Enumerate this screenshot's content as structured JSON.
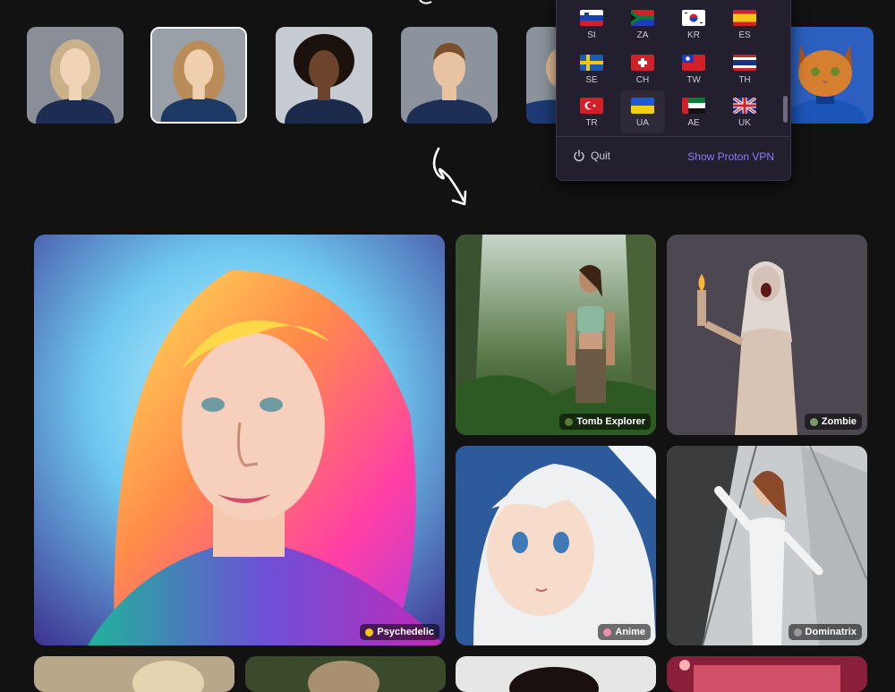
{
  "avatars": [
    {
      "name": "portrait-1",
      "bg": "#8a8f97",
      "skin": "#f1d3b6",
      "hair": "#c9b28a",
      "shirt": "#1d2c52"
    },
    {
      "name": "portrait-2",
      "bg": "#9aa0a8",
      "skin": "#efcfae",
      "hair": "#b88d5a",
      "shirt": "#1d3a66",
      "selected": true
    },
    {
      "name": "portrait-3",
      "bg": "#c7cbd2",
      "skin": "#6b442b",
      "hair": "#1b120d",
      "shirt": "#1b2a4a"
    },
    {
      "name": "portrait-4",
      "bg": "#8c939c",
      "skin": "#e8c3a2",
      "hair": "#7a4f2c",
      "shirt": "#1d2f55"
    },
    {
      "name": "portrait-5",
      "bg": "#8c939c",
      "skin": "#e1b692",
      "hair": "#5a3a22",
      "shirt": "#1d3a74"
    },
    {
      "name": "portrait-cat",
      "bg": "#2c5fbf",
      "skin": "#d58030",
      "hair": "#a85620",
      "shirt": "#1c55b8"
    }
  ],
  "vpn": {
    "countries": [
      {
        "code": "SI"
      },
      {
        "code": "ZA"
      },
      {
        "code": "KR"
      },
      {
        "code": "ES"
      },
      {
        "code": "SE"
      },
      {
        "code": "CH"
      },
      {
        "code": "TW"
      },
      {
        "code": "TH"
      },
      {
        "code": "TR"
      },
      {
        "code": "UA"
      },
      {
        "code": "AE"
      },
      {
        "code": "UK"
      }
    ],
    "quit_label": "Quit",
    "show_label": "Show Proton VPN"
  },
  "gallery": {
    "tiles": [
      {
        "label": "Psychedelic",
        "icon_color": "#f5c518"
      },
      {
        "label": "Tomb Explorer",
        "icon_color": "#5a7a3a"
      },
      {
        "label": "Zombie",
        "icon_color": "#7a9a6a"
      },
      {
        "label": "Anime",
        "icon_color": "#f08fb0"
      },
      {
        "label": "Dominatrix",
        "icon_color": "#9a9a9a"
      }
    ]
  }
}
